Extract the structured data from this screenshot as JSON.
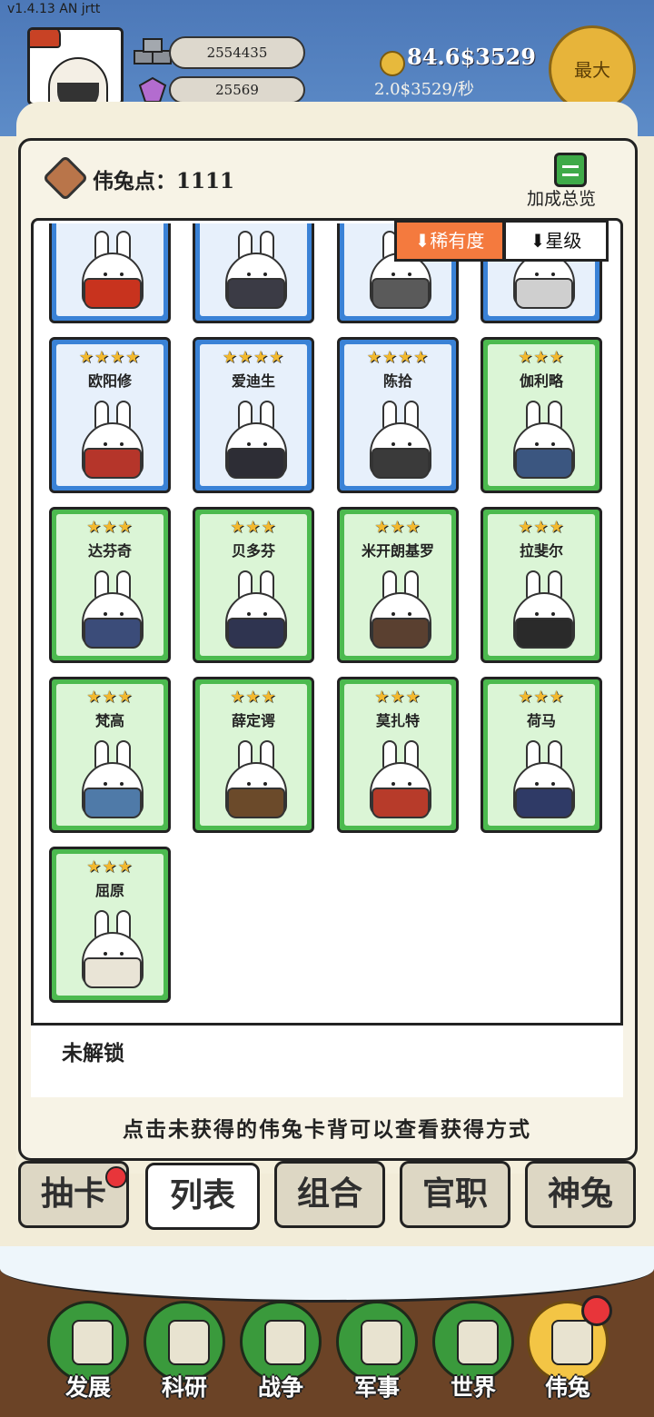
{
  "version": "v1.4.13 AN jrtt",
  "resources": {
    "stone": "2554435",
    "crystal": "25569",
    "money": "84.6$3529",
    "rate": "2.0$3529/秒",
    "max_label": "最大"
  },
  "panel": {
    "points_label": "伟兔点：1111",
    "bonus_label": "加成总览",
    "sort_rarity": "⬇稀有度",
    "sort_star": "⬇星级",
    "locked_label": "未解锁",
    "hint": "点击未获得的伟兔卡背可以查看获得方式"
  },
  "cards": [
    {
      "name": "",
      "stars": "",
      "tier": "blue",
      "outfit": "#c8331e"
    },
    {
      "name": "",
      "stars": "",
      "tier": "blue",
      "outfit": "#3b3b45"
    },
    {
      "name": "",
      "stars": "",
      "tier": "blue",
      "outfit": "#5a5a5a"
    },
    {
      "name": "",
      "stars": "",
      "tier": "blue",
      "outfit": "#cfcfcf"
    },
    {
      "name": "欧阳修",
      "stars": "★★★★",
      "tier": "blue",
      "outfit": "#b5352a"
    },
    {
      "name": "爱迪生",
      "stars": "★★★★",
      "tier": "blue",
      "outfit": "#2d2d35"
    },
    {
      "name": "陈拾",
      "stars": "★★★★",
      "tier": "blue",
      "outfit": "#3a3a3a"
    },
    {
      "name": "伽利略",
      "stars": "★★★",
      "tier": "green",
      "outfit": "#3b5680"
    },
    {
      "name": "达芬奇",
      "stars": "★★★",
      "tier": "green",
      "outfit": "#3b4c79"
    },
    {
      "name": "贝多芬",
      "stars": "★★★",
      "tier": "green",
      "outfit": "#2f3450"
    },
    {
      "name": "米开朗基罗",
      "stars": "★★★",
      "tier": "green",
      "outfit": "#5a4030"
    },
    {
      "name": "拉斐尔",
      "stars": "★★★",
      "tier": "green",
      "outfit": "#2a2a2a"
    },
    {
      "name": "梵高",
      "stars": "★★★",
      "tier": "green",
      "outfit": "#4f7aa8"
    },
    {
      "name": "薛定谔",
      "stars": "★★★",
      "tier": "green",
      "outfit": "#6b4a2a"
    },
    {
      "name": "莫扎特",
      "stars": "★★★",
      "tier": "green",
      "outfit": "#b73b2a"
    },
    {
      "name": "荷马",
      "stars": "★★★",
      "tier": "green",
      "outfit": "#2f3a66"
    },
    {
      "name": "屈原",
      "stars": "★★★",
      "tier": "green",
      "outfit": "#e9e4d6"
    }
  ],
  "tabs": [
    {
      "label": "抽卡"
    },
    {
      "label": "列表"
    },
    {
      "label": "组合"
    },
    {
      "label": "官职"
    },
    {
      "label": "神兔"
    }
  ],
  "nav": [
    {
      "label": "发展",
      "icon": "develop-icon"
    },
    {
      "label": "科研",
      "icon": "flask-icon"
    },
    {
      "label": "战争",
      "icon": "crossed-swords-icon"
    },
    {
      "label": "军事",
      "icon": "tent-icon"
    },
    {
      "label": "世界",
      "icon": "globe-icon"
    },
    {
      "label": "伟兔",
      "icon": "rabbit-card-icon"
    }
  ]
}
